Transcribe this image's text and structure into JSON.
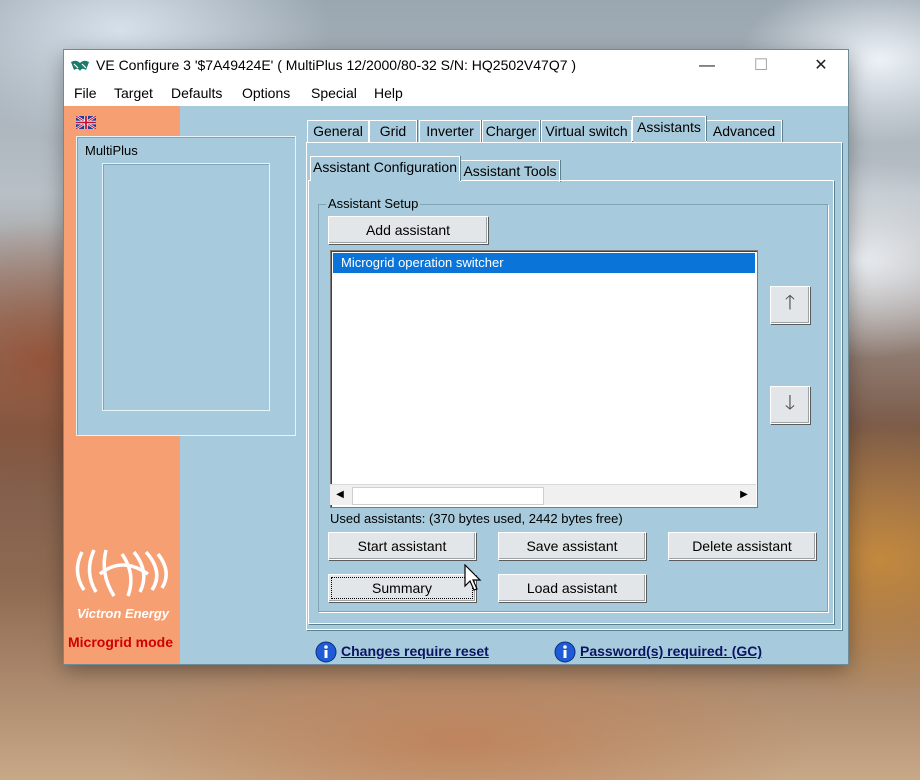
{
  "window": {
    "title": "VE Configure 3    '$7A49424E' ( MultiPlus 12/2000/80-32 S/N: HQ2502V47Q7 )",
    "minimize": "—",
    "maximize": "☐",
    "close": "✕"
  },
  "menu": [
    "File",
    "Target",
    "Defaults",
    "Options",
    "Special",
    "Help"
  ],
  "device": {
    "label": "MultiPlus"
  },
  "branding": {
    "company": "Victron Energy",
    "mode": "Microgrid mode"
  },
  "tabs": [
    "General",
    "Grid",
    "Inverter",
    "Charger",
    "Virtual switch",
    "Assistants",
    "Advanced"
  ],
  "active_tab": "Assistants",
  "subtabs": [
    "Assistant Configuration",
    "Assistant Tools"
  ],
  "active_subtab": "Assistant Configuration",
  "assistant_setup": {
    "group_title": "Assistant Setup",
    "add_label": "Add assistant",
    "list_items": [
      "Microgrid operation switcher"
    ],
    "selected_index": 0,
    "up_glyph": "🡑",
    "down_glyph": "🡓",
    "scroll_left": "◀",
    "scroll_right": "▶",
    "usage_text": "Used assistants: (370 bytes used, 2442 bytes free)",
    "start_label": "Start assistant",
    "save_label": "Save assistant",
    "delete_label": "Delete assistant",
    "summary_label": "Summary",
    "load_label": "Load assistant"
  },
  "status": {
    "reset_text": "Changes require reset",
    "password_text": "Password(s) required: (GC)"
  },
  "colors": {
    "window_bg": "#a7cbdc",
    "left_strip": "#f59f73",
    "selection": "#0a74d8",
    "mode_text": "#d10000",
    "link_text": "#0b1460"
  }
}
